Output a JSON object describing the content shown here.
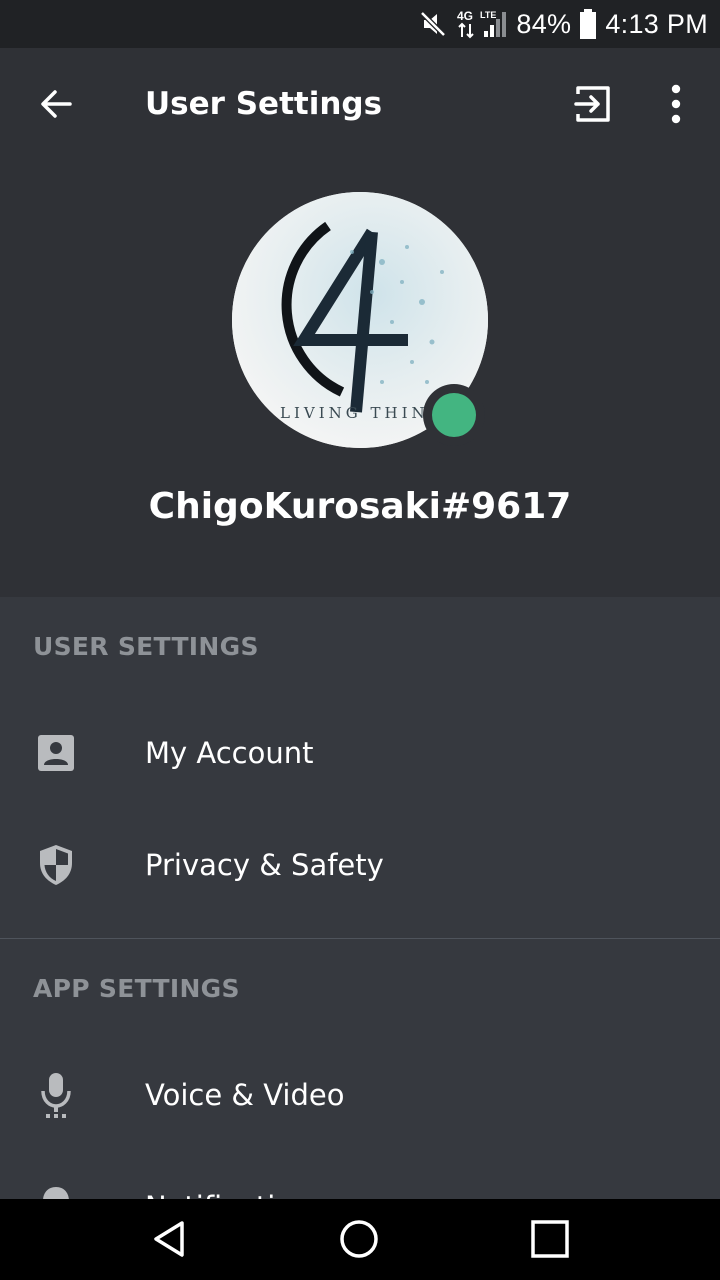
{
  "status_bar": {
    "battery_percent": "84%",
    "time": "4:13 PM",
    "network_label": "4G",
    "lte_label": "LTE",
    "icons": [
      "mute-icon",
      "network-4g-lte-icon",
      "signal-icon",
      "battery-icon"
    ]
  },
  "header": {
    "title": "User Settings",
    "icons": [
      "arrow-back-icon",
      "logout-icon",
      "more-vertical-icon"
    ]
  },
  "profile": {
    "username": "ChigoKurosaki#9617",
    "avatar_text": "LIVING THING",
    "online_status_color": "#43b581"
  },
  "sections": [
    {
      "header": "USER SETTINGS",
      "items": [
        {
          "label": "My Account",
          "icon": "account-icon"
        },
        {
          "label": "Privacy & Safety",
          "icon": "shield-icon"
        }
      ]
    },
    {
      "header": "APP SETTINGS",
      "items": [
        {
          "label": "Voice & Video",
          "icon": "microphone-icon"
        },
        {
          "label": "Notifications",
          "icon": "bell-icon"
        }
      ]
    }
  ],
  "nav_bar": {
    "icons": [
      "nav-back-icon",
      "nav-home-icon",
      "nav-recents-icon"
    ]
  },
  "colors": {
    "status_bar_bg": "#202225",
    "profile_bg": "#2f3136",
    "list_bg": "#36393f",
    "section_header": "#8e9297",
    "icon_gray": "#b9bbbe",
    "online_green": "#43b581"
  }
}
